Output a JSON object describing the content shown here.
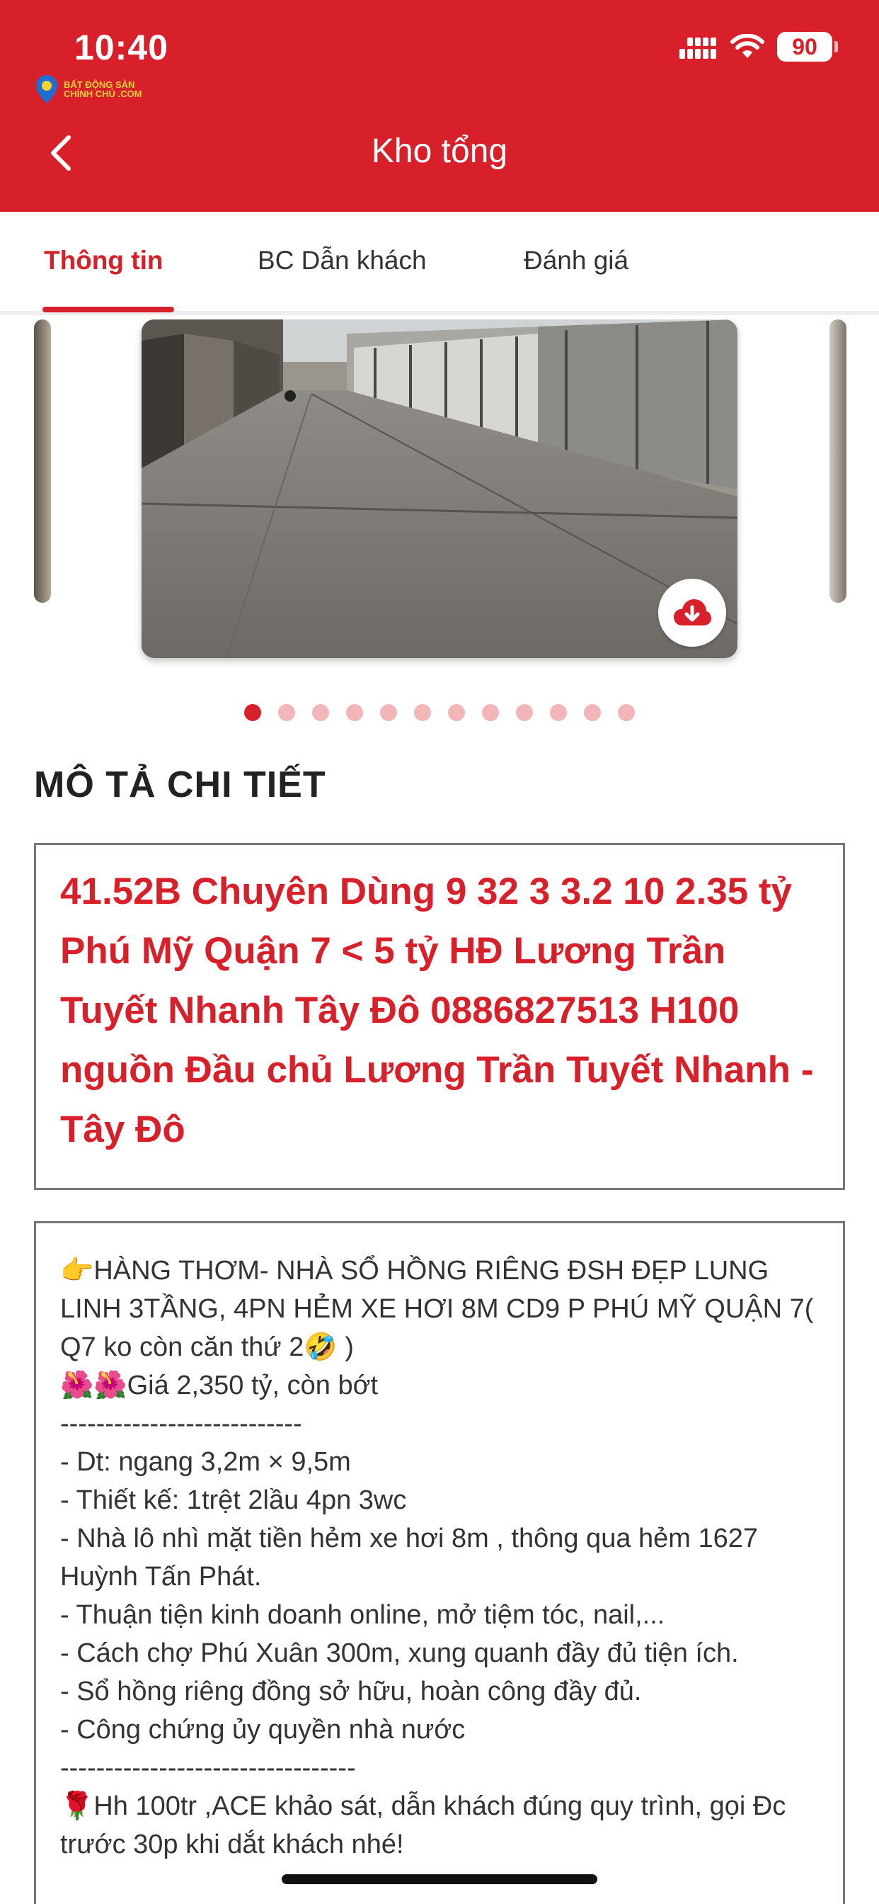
{
  "status_bar": {
    "time": "10:40",
    "battery": "90"
  },
  "app": {
    "logo_line1": "BẤT ĐỘNG SẢN",
    "logo_line2": "CHÍNH CHỦ .COM"
  },
  "header": {
    "title": "Kho tổng"
  },
  "tabs": [
    {
      "label": "Thông tin"
    },
    {
      "label": "BC Dẫn khách"
    },
    {
      "label": "Đánh giá"
    }
  ],
  "carousel": {
    "active_index": 0,
    "total": 12
  },
  "section": {
    "title": "MÔ TẢ CHI TIẾT"
  },
  "listing": {
    "title": "41.52B Chuyên Dùng 9 32 3 3.2 10 2.35 tỷ Phú Mỹ Quận 7 < 5 tỷ HĐ Lương Trần Tuyết Nhanh Tây Đô 0886827513 H100 nguồn Đầu chủ Lương Trần Tuyết Nhanh - Tây Đô",
    "description": [
      "👉HÀNG THƠM- NHÀ SỔ HỒNG RIÊNG ĐSH ĐẸP LUNG LINH 3TẦNG, 4PN HẺM XE HƠI 8M CD9 P PHÚ MỸ QUẬN 7( Q7 ko còn căn thứ 2🤣 )",
      "🌺🌺Giá 2,350 tỷ, còn bớt",
      "---------------------------",
      "- Dt: ngang 3,2m × 9,5m",
      "- Thiết kế: 1trệt 2lầu 4pn 3wc",
      "- Nhà lô nhì mặt tiền hẻm xe hơi 8m , thông qua hẻm 1627 Huỳnh Tấn Phát.",
      "- Thuận tiện kinh doanh online, mở tiệm tóc, nail,...",
      "- Cách chợ Phú Xuân 300m, xung quanh đầy đủ tiện ích.",
      "- Sổ hồng riêng đồng sở hữu, hoàn công đầy đủ.",
      "- Công chứng ủy quyền nhà nước",
      "---------------------------------",
      "🌹Hh 100tr ,ACE khảo sát, dẫn khách đúng quy trình, gọi Đc trước 30p khi dắt khách nhé!"
    ]
  },
  "colors": {
    "brand_red": "#d8202a",
    "dot_inactive": "#f2b6b9"
  }
}
